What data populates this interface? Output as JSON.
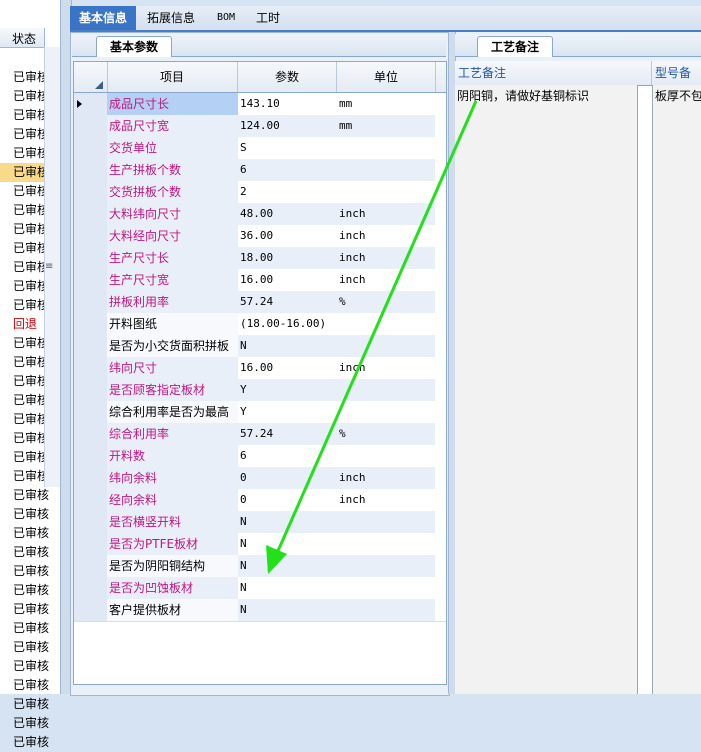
{
  "left_list": {
    "header": "状态",
    "statuses": [
      {
        "text": "已审核",
        "color": "#000000"
      },
      {
        "text": "已审核",
        "color": "#000000"
      },
      {
        "text": "已审核",
        "color": "#000000"
      },
      {
        "text": "已审核",
        "color": "#000000"
      },
      {
        "text": "已审核",
        "color": "#000000"
      },
      {
        "text": "已审核",
        "color": "#000000",
        "highlight": "#f9d98a"
      },
      {
        "text": "已审核",
        "color": "#000000"
      },
      {
        "text": "已审核",
        "color": "#000000"
      },
      {
        "text": "已审核",
        "color": "#000000"
      },
      {
        "text": "已审核",
        "color": "#000000"
      },
      {
        "text": "已审核",
        "color": "#000000"
      },
      {
        "text": "已审核",
        "color": "#000000"
      },
      {
        "text": "已审核",
        "color": "#000000"
      },
      {
        "text": "回退",
        "color": "#d40000"
      },
      {
        "text": "已审核",
        "color": "#000000"
      },
      {
        "text": "已审核",
        "color": "#000000"
      },
      {
        "text": "已审核",
        "color": "#000000"
      },
      {
        "text": "已审核",
        "color": "#000000"
      },
      {
        "text": "已审核",
        "color": "#000000"
      },
      {
        "text": "已审核",
        "color": "#000000"
      },
      {
        "text": "已审核",
        "color": "#000000"
      },
      {
        "text": "已审核",
        "color": "#000000"
      },
      {
        "text": "已审核",
        "color": "#000000"
      },
      {
        "text": "已审核",
        "color": "#000000"
      },
      {
        "text": "已审核",
        "color": "#000000"
      },
      {
        "text": "已审核",
        "color": "#000000"
      },
      {
        "text": "已审核",
        "color": "#000000"
      },
      {
        "text": "已审核",
        "color": "#000000"
      },
      {
        "text": "已审核",
        "color": "#000000"
      },
      {
        "text": "已审核",
        "color": "#000000"
      },
      {
        "text": "已审核",
        "color": "#000000"
      },
      {
        "text": "已审核",
        "color": "#000000"
      },
      {
        "text": "已审核",
        "color": "#000000"
      },
      {
        "text": "已审核",
        "color": "#000000"
      },
      {
        "text": "已审核",
        "color": "#000000"
      },
      {
        "text": "已审核",
        "color": "#000000"
      }
    ]
  },
  "top_tabs": [
    "基本信息",
    "拓展信息",
    "BOM",
    "工时"
  ],
  "main": {
    "sub_tab": "基本参数",
    "columns": [
      "项目",
      "参数",
      "单位"
    ],
    "rows": [
      {
        "item": "成品尺寸长",
        "value": "143.10",
        "unit": "mm",
        "pink": true,
        "selected": true
      },
      {
        "item": "成品尺寸宽",
        "value": "124.00",
        "unit": "mm",
        "pink": true
      },
      {
        "item": "交货单位",
        "value": "S",
        "unit": "",
        "pink": true
      },
      {
        "item": "生产拼板个数",
        "value": "6",
        "unit": "",
        "pink": true
      },
      {
        "item": "交货拼板个数",
        "value": "2",
        "unit": "",
        "pink": true
      },
      {
        "item": "大料纬向尺寸",
        "value": "48.00",
        "unit": "inch",
        "pink": true
      },
      {
        "item": "大料经向尺寸",
        "value": "36.00",
        "unit": "inch",
        "pink": true
      },
      {
        "item": "生产尺寸长",
        "value": "18.00",
        "unit": "inch",
        "pink": true
      },
      {
        "item": "生产尺寸宽",
        "value": "16.00",
        "unit": "inch",
        "pink": true
      },
      {
        "item": "拼板利用率",
        "value": "57.24",
        "unit": "%",
        "pink": true
      },
      {
        "item": "开料图纸",
        "value": "(18.00-16.00)",
        "unit": "",
        "pink": false
      },
      {
        "item": "是否为小交货面积拼板",
        "value": "N",
        "unit": "",
        "pink": false
      },
      {
        "item": "纬向尺寸",
        "value": "16.00",
        "unit": "inch",
        "pink": true
      },
      {
        "item": "是否顾客指定板材",
        "value": "Y",
        "unit": "",
        "pink": true
      },
      {
        "item": "综合利用率是否为最高",
        "value": "Y",
        "unit": "",
        "pink": false
      },
      {
        "item": "综合利用率",
        "value": "57.24",
        "unit": "%",
        "pink": true
      },
      {
        "item": "开料数",
        "value": "6",
        "unit": "",
        "pink": true
      },
      {
        "item": "纬向余料",
        "value": "0",
        "unit": "inch",
        "pink": true
      },
      {
        "item": "经向余料",
        "value": "0",
        "unit": "inch",
        "pink": true
      },
      {
        "item": "是否横竖开料",
        "value": "N",
        "unit": "",
        "pink": true
      },
      {
        "item": "是否为PTFE板材",
        "value": "N",
        "unit": "",
        "pink": true
      },
      {
        "item": "是否为阴阳铜结构",
        "value": "N",
        "unit": "",
        "pink": false
      },
      {
        "item": "是否为凹蚀板材",
        "value": "N",
        "unit": "",
        "pink": true
      },
      {
        "item": "客户提供板材",
        "value": "N",
        "unit": "",
        "pink": false
      }
    ]
  },
  "right": {
    "sub_tab": "工艺备注",
    "columns": [
      "工艺备注",
      "型号备注"
    ],
    "values": [
      "阴阳铜，请做好基铜标识",
      "板厚不包"
    ]
  },
  "colors": {
    "pink_text": "#c0177f",
    "accent": "#3a74c6",
    "arrow": "#22e01a"
  },
  "icons": {
    "row_indicator": "triangle-right-icon",
    "grip": "grip-icon"
  }
}
